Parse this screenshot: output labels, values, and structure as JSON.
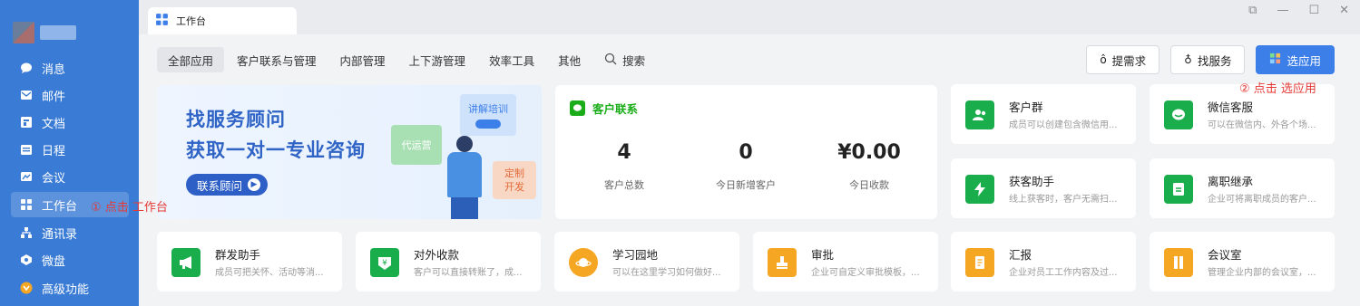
{
  "sidebar": {
    "items": [
      {
        "label": "消息",
        "icon": "message-icon"
      },
      {
        "label": "邮件",
        "icon": "mail-icon"
      },
      {
        "label": "文档",
        "icon": "doc-icon"
      },
      {
        "label": "日程",
        "icon": "calendar-icon"
      },
      {
        "label": "会议",
        "icon": "meeting-icon"
      },
      {
        "label": "工作台",
        "icon": "workbench-icon"
      },
      {
        "label": "通讯录",
        "icon": "contacts-icon"
      },
      {
        "label": "微盘",
        "icon": "disk-icon"
      },
      {
        "label": "高级功能",
        "icon": "advanced-icon"
      }
    ],
    "active_index": 5
  },
  "annotations": {
    "step1": "① 点击 工作台",
    "step2": "② 点击 选应用"
  },
  "tab": {
    "label": "工作台"
  },
  "filters": [
    "全部应用",
    "客户联系与管理",
    "内部管理",
    "上下游管理",
    "效率工具",
    "其他"
  ],
  "search_label": "搜索",
  "actions": {
    "request": "提需求",
    "service": "找服务",
    "select_app": "选应用"
  },
  "banner": {
    "line1": "找服务顾问",
    "line2": "获取一对一专业咨询",
    "cta": "联系顾问",
    "tag_training": "讲解培训",
    "tag_operate": "代运营",
    "tag_custom_a": "定制",
    "tag_custom_b": "开发"
  },
  "stats": {
    "title": "客户联系",
    "items": [
      {
        "value": "4",
        "label": "客户总数"
      },
      {
        "value": "0",
        "label": "今日新增客户"
      },
      {
        "value": "¥0.00",
        "label": "今日收款"
      }
    ]
  },
  "cards": [
    {
      "title": "客户群",
      "desc": "成员可以创建包含微信用...",
      "color": "#1aad4b",
      "icon": "customer-group-icon"
    },
    {
      "title": "微信客服",
      "desc": "可以在微信内、外各个场...",
      "color": "#1aad4b",
      "icon": "wechat-service-icon"
    },
    {
      "title": "获客助手",
      "desc": "线上获客时，客户无需扫...",
      "color": "#1aad4b",
      "icon": "lightning-icon"
    },
    {
      "title": "离职继承",
      "desc": "企业可将离职成员的客户...",
      "color": "#1aad4b",
      "icon": "inherit-icon"
    },
    {
      "title": "群发助手",
      "desc": "成员可把关怀、活动等消...",
      "color": "#1aad4b",
      "icon": "megaphone-icon"
    },
    {
      "title": "对外收款",
      "desc": "客户可以直接转账了，成...",
      "color": "#1aad4b",
      "icon": "yuan-icon"
    },
    {
      "title": "学习园地",
      "desc": "可以在这里学习如何做好...",
      "color": "#f5a623",
      "icon": "planet-icon"
    },
    {
      "title": "审批",
      "desc": "企业可自定义审批模板，...",
      "color": "#f5a623",
      "icon": "stamp-icon"
    },
    {
      "title": "汇报",
      "desc": "企业对员工工作内容及过...",
      "color": "#f5a623",
      "icon": "report-icon"
    },
    {
      "title": "会议室",
      "desc": "管理企业内部的会议室，...",
      "color": "#f5a623",
      "icon": "door-icon"
    }
  ]
}
